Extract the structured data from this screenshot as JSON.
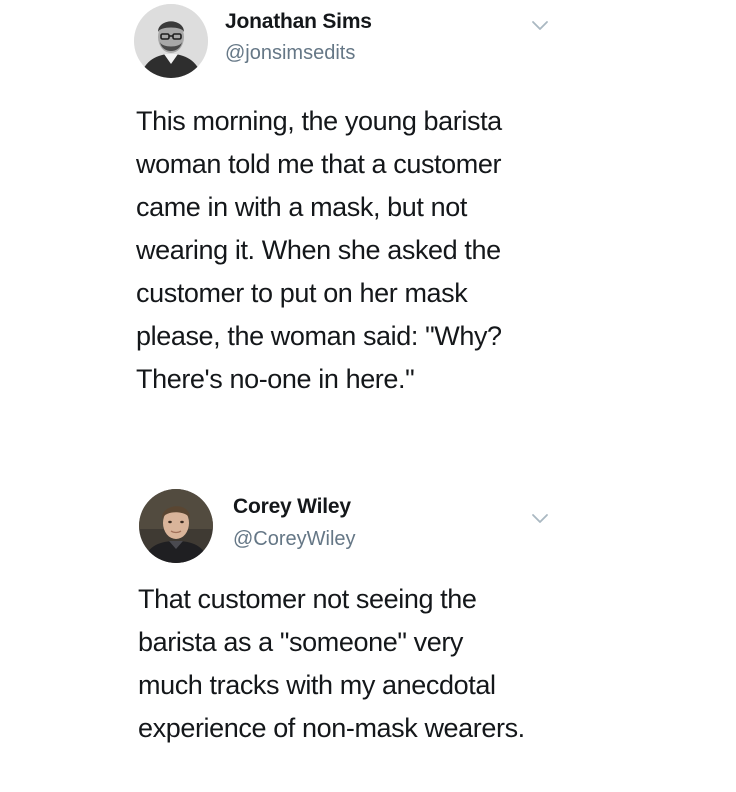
{
  "tweets": [
    {
      "name": "Jonathan Sims",
      "handle": "@jonsimsedits",
      "menu_icon": "chevron-down-icon",
      "body_lines": [
        "This morning, the young barista",
        "woman told me that a customer",
        "came in with a mask, but not",
        "wearing it. When she asked the",
        "customer to put on her mask",
        "please, the woman said: \"Why?",
        "There's no-one in here.\""
      ]
    },
    {
      "name": "Corey Wiley",
      "handle": "@CoreyWiley",
      "menu_icon": "chevron-down-icon",
      "body_lines": [
        "That customer not seeing the",
        "barista as a \"someone\" very",
        "much tracks with my anecdotal",
        "experience of non-mask wearers."
      ]
    }
  ],
  "colors": {
    "text": "#14171a",
    "secondary": "#657786",
    "chevron": "#aab8c2"
  }
}
